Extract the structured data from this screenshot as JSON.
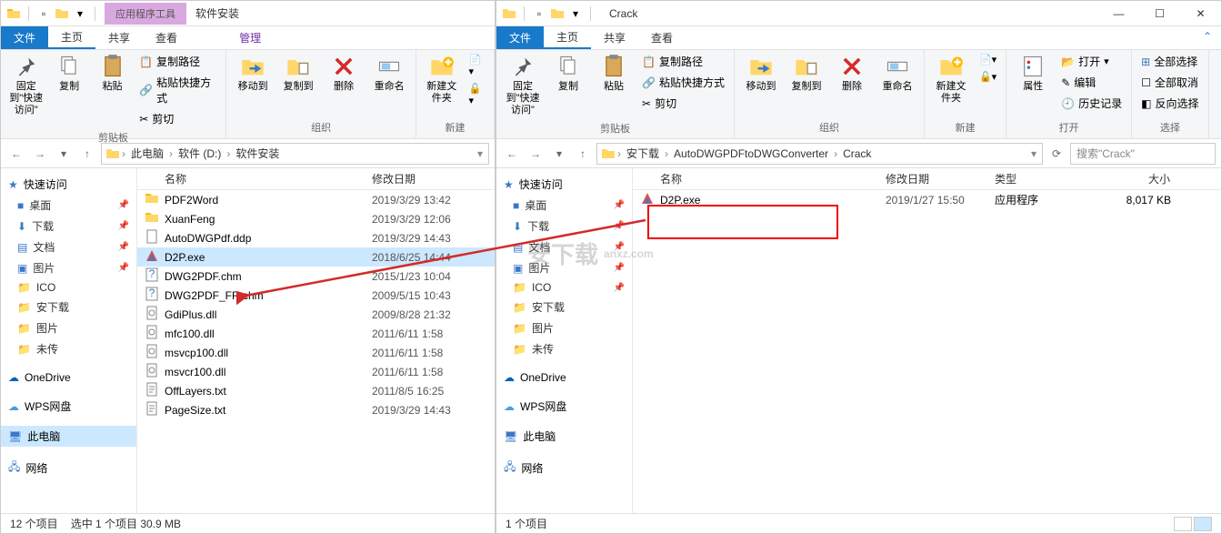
{
  "left": {
    "title_ctx": "应用程序工具",
    "title": "软件安装",
    "tabs": {
      "file": "文件",
      "home": "主页",
      "share": "共享",
      "view": "查看",
      "ctx": "管理"
    },
    "ribbon": {
      "pin": "固定到\"快速访问\"",
      "copy": "复制",
      "paste": "粘贴",
      "copypath": "复制路径",
      "pastelnk": "粘贴快捷方式",
      "cut": "剪切",
      "clip_grp": "剪贴板",
      "moveto": "移动到",
      "copyto": "复制到",
      "delete": "删除",
      "rename": "重命名",
      "org_grp": "组织",
      "newfolder": "新建文件夹",
      "new_grp": "新建"
    },
    "crumbs": [
      "此电脑",
      "软件 (D:)",
      "软件安装"
    ],
    "nav": {
      "quick": "快速访问",
      "desktop": "桌面",
      "downloads": "下载",
      "documents": "文档",
      "pictures": "图片",
      "ico": "ICO",
      "anxz": "安下载",
      "pic2": "图片",
      "wc": "未传",
      "onedrive": "OneDrive",
      "wps": "WPS网盘",
      "thispc": "此电脑",
      "network": "网络"
    },
    "cols": {
      "name": "名称",
      "date": "修改日期"
    },
    "files": [
      {
        "name": "PDF2Word",
        "date": "2019/3/29 13:42",
        "ic": "folder"
      },
      {
        "name": "XuanFeng",
        "date": "2019/3/29 12:06",
        "ic": "folder"
      },
      {
        "name": "AutoDWGPdf.ddp",
        "date": "2019/3/29 14:43",
        "ic": "file"
      },
      {
        "name": "D2P.exe",
        "date": "2018/6/25 14:44",
        "ic": "app"
      },
      {
        "name": "DWG2PDF.chm",
        "date": "2015/1/23 10:04",
        "ic": "chm"
      },
      {
        "name": "DWG2PDF_FR.chm",
        "date": "2009/5/15 10:43",
        "ic": "chm"
      },
      {
        "name": "GdiPlus.dll",
        "date": "2009/8/28 21:32",
        "ic": "dll"
      },
      {
        "name": "mfc100.dll",
        "date": "2011/6/11 1:58",
        "ic": "dll"
      },
      {
        "name": "msvcp100.dll",
        "date": "2011/6/11 1:58",
        "ic": "dll"
      },
      {
        "name": "msvcr100.dll",
        "date": "2011/6/11 1:58",
        "ic": "dll"
      },
      {
        "name": "OffLayers.txt",
        "date": "2011/8/5 16:25",
        "ic": "txt"
      },
      {
        "name": "PageSize.txt",
        "date": "2019/3/29 14:43",
        "ic": "txt"
      }
    ],
    "status": {
      "count": "12 个项目",
      "sel": "选中 1 个项目 30.9 MB"
    }
  },
  "right": {
    "title": "Crack",
    "tabs": {
      "file": "文件",
      "home": "主页",
      "share": "共享",
      "view": "查看"
    },
    "ribbon": {
      "pin": "固定到\"快速访问\"",
      "copy": "复制",
      "paste": "粘贴",
      "copypath": "复制路径",
      "pastelnk": "粘贴快捷方式",
      "cut": "剪切",
      "clip_grp": "剪贴板",
      "moveto": "移动到",
      "copyto": "复制到",
      "delete": "删除",
      "rename": "重命名",
      "org_grp": "组织",
      "newfolder": "新建文件夹",
      "new_grp": "新建",
      "props": "属性",
      "open": "打开",
      "edit": "编辑",
      "history": "历史记录",
      "open_grp": "打开",
      "selall": "全部选择",
      "selnone": "全部取消",
      "selinv": "反向选择",
      "sel_grp": "选择"
    },
    "crumbs": [
      "安下载",
      "AutoDWGPDFtoDWGConverter",
      "Crack"
    ],
    "search_ph": "搜索\"Crack\"",
    "nav": {
      "quick": "快速访问",
      "desktop": "桌面",
      "downloads": "下载",
      "documents": "文档",
      "pictures": "图片",
      "ico": "ICO",
      "anxz": "安下载",
      "pic2": "图片",
      "wc": "未传",
      "onedrive": "OneDrive",
      "wps": "WPS网盘",
      "thispc": "此电脑",
      "network": "网络"
    },
    "cols": {
      "name": "名称",
      "date": "修改日期",
      "type": "类型",
      "size": "大小"
    },
    "files": [
      {
        "name": "D2P.exe",
        "date": "2019/1/27 15:50",
        "type": "应用程序",
        "size": "8,017 KB",
        "ic": "app"
      }
    ],
    "status": {
      "count": "1 个项目"
    }
  },
  "watermark": "anxz.com"
}
